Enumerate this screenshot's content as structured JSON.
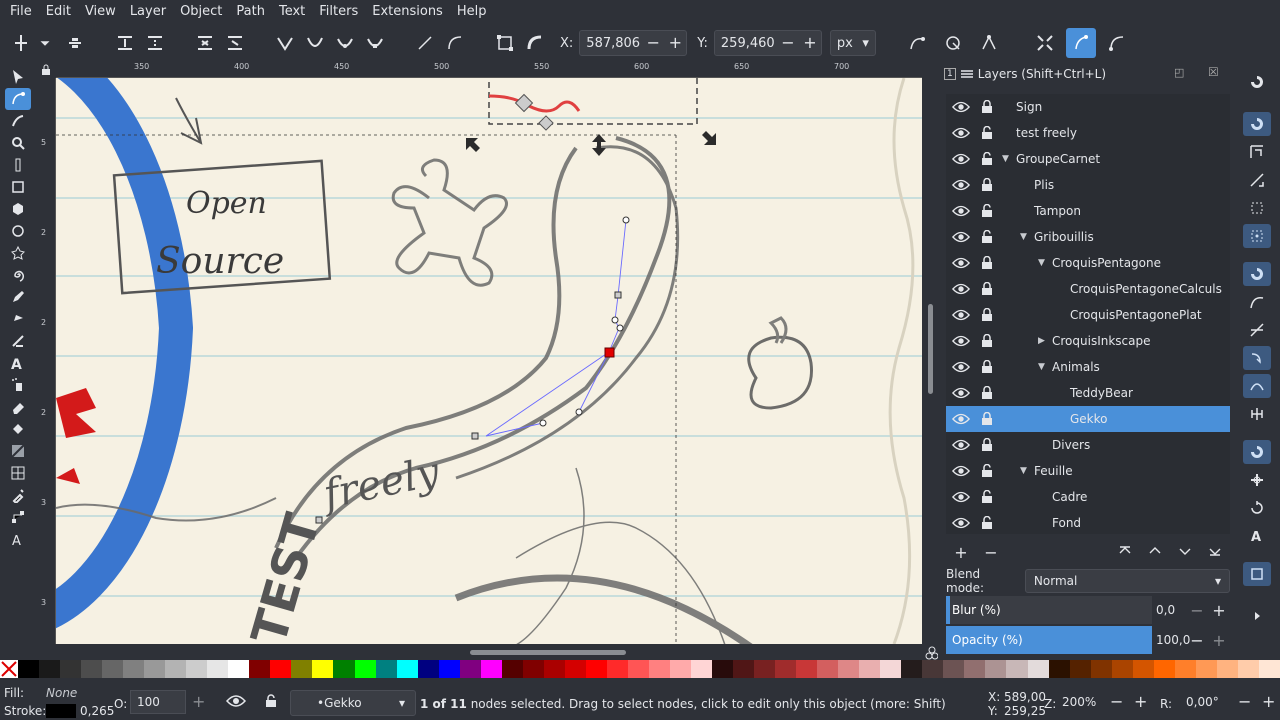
{
  "menu": [
    "File",
    "Edit",
    "View",
    "Layer",
    "Object",
    "Path",
    "Text",
    "Filters",
    "Extensions",
    "Help"
  ],
  "toolbar": {
    "x_label": "X:",
    "x_value": "587,806",
    "y_label": "Y:",
    "y_value": "259,460",
    "unit": "px"
  },
  "ruler_top": [
    "350",
    "400",
    "450",
    "500",
    "550",
    "600",
    "650",
    "700"
  ],
  "ruler_left": [
    "5",
    "2",
    "2",
    "2",
    "3",
    "3"
  ],
  "canvas": {
    "sign_text_1": "Open",
    "sign_text_2": "Source",
    "freely": "freely",
    "test": "TEST"
  },
  "panel": {
    "title": "Layers (Shift+Ctrl+L)",
    "layers": [
      {
        "name": "Sign",
        "depth": 0,
        "expander": "",
        "locked": true
      },
      {
        "name": "test freely",
        "depth": 0,
        "expander": "",
        "locked": false
      },
      {
        "name": "GroupeCarnet",
        "depth": 0,
        "expander": "down",
        "locked": false
      },
      {
        "name": "Plis",
        "depth": 1,
        "expander": "",
        "locked": true
      },
      {
        "name": "Tampon",
        "depth": 1,
        "expander": "",
        "locked": false
      },
      {
        "name": "Gribouillis",
        "depth": 1,
        "expander": "down",
        "locked": false
      },
      {
        "name": "CroquisPentagone",
        "depth": 2,
        "expander": "down",
        "locked": true
      },
      {
        "name": "CroquisPentagoneCalculs",
        "depth": 3,
        "expander": "",
        "locked": true
      },
      {
        "name": "CroquisPentagonePlat",
        "depth": 3,
        "expander": "",
        "locked": true
      },
      {
        "name": "CroquisInkscape",
        "depth": 2,
        "expander": "right",
        "locked": true
      },
      {
        "name": "Animals",
        "depth": 2,
        "expander": "down",
        "locked": true
      },
      {
        "name": "TeddyBear",
        "depth": 3,
        "expander": "",
        "locked": true
      },
      {
        "name": "Gekko",
        "depth": 3,
        "expander": "",
        "locked": true,
        "selected": true
      },
      {
        "name": "Divers",
        "depth": 2,
        "expander": "",
        "locked": true
      },
      {
        "name": "Feuille",
        "depth": 1,
        "expander": "down",
        "locked": false
      },
      {
        "name": "Cadre",
        "depth": 2,
        "expander": "",
        "locked": false
      },
      {
        "name": "Fond",
        "depth": 2,
        "expander": "",
        "locked": false
      }
    ],
    "blend_label": "Blend mode:",
    "blend_value": "Normal",
    "blur_label": "Blur (%)",
    "blur_value": "0,0",
    "blur_fraction": 0.02,
    "opacity_label": "Opacity (%)",
    "opacity_value": "100,0",
    "opacity_fraction": 1.0
  },
  "palette": [
    "#000000",
    "#1a1a1a",
    "#333333",
    "#4d4d4d",
    "#666666",
    "#808080",
    "#999999",
    "#b3b3b3",
    "#cccccc",
    "#e6e6e6",
    "#ffffff",
    "#800000",
    "#ff0000",
    "#808000",
    "#ffff00",
    "#008000",
    "#00ff00",
    "#008080",
    "#00ffff",
    "#000080",
    "#0000ff",
    "#800080",
    "#ff00ff",
    "#550000",
    "#800000",
    "#aa0000",
    "#d40000",
    "#ff0000",
    "#ff2a2a",
    "#ff5555",
    "#ff8080",
    "#ffaaaa",
    "#ffd5d5",
    "#280b0b",
    "#501616",
    "#782121",
    "#a02c2c",
    "#c83737",
    "#d35f5f",
    "#de8787",
    "#e9afaf",
    "#f4d7d7",
    "#241c1c",
    "#483737",
    "#6c5353",
    "#916f6f",
    "#ac9393",
    "#c8b7b7",
    "#e3dbdb",
    "#2b1100",
    "#552200",
    "#803300",
    "#aa4400",
    "#d45500",
    "#ff6600",
    "#ff7f2a",
    "#ff9955",
    "#ffb380",
    "#ffccaa",
    "#ffe6d5"
  ],
  "status": {
    "fill_label": "Fill:",
    "fill_value": "None",
    "stroke_label": "Stroke:",
    "stroke_width": "0,265",
    "opacity_label": "O:",
    "opacity_value": "100",
    "layer": "•Gekko",
    "message_bold": "1 of 11",
    "message": " nodes selected. Drag to select nodes, click to edit only this object (more: Shift)",
    "x_label": "X:",
    "x_value": "589,00",
    "y_label": "Y:",
    "y_value": "259,25",
    "zoom_label": "Z:",
    "zoom_value": "200%",
    "rot_label": "R:",
    "rot_value": "0,00°"
  }
}
